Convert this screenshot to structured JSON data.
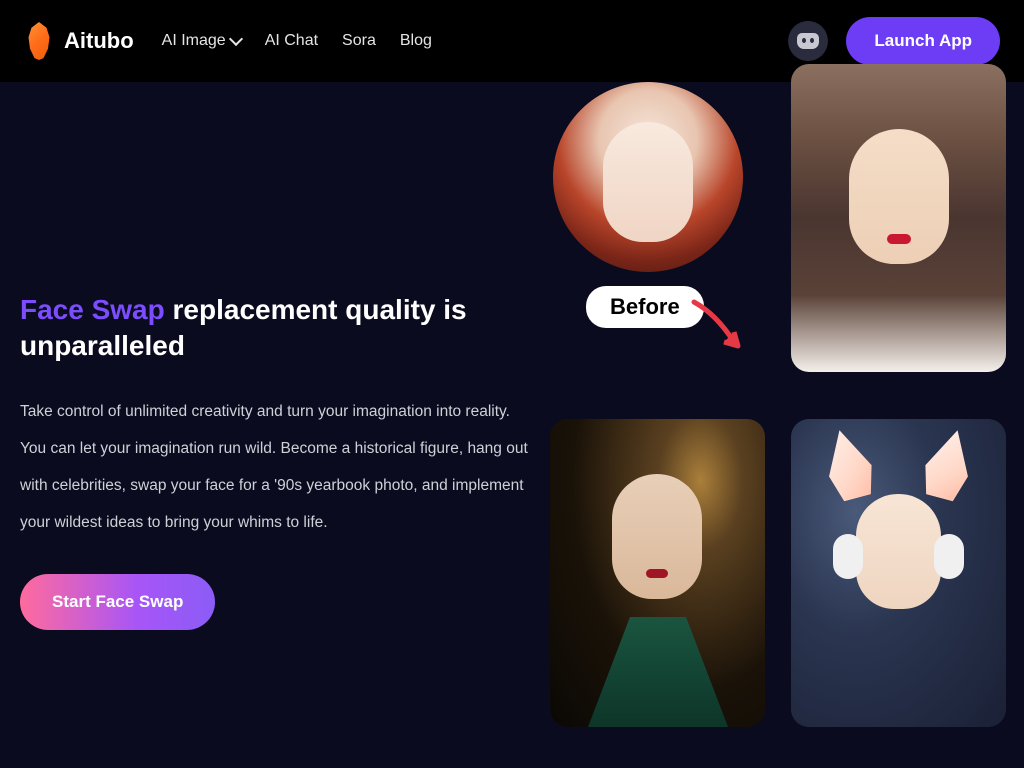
{
  "header": {
    "brand": "Aitubo",
    "nav": {
      "ai_image": "AI Image",
      "ai_chat": "AI Chat",
      "sora": "Sora",
      "blog": "Blog"
    },
    "launch_label": "Launch App"
  },
  "hero": {
    "heading_highlight": "Face Swap",
    "heading_rest": " replacement quality is unparalleled",
    "description": "Take control of unlimited creativity and turn your imagination into reality. You can let your imagination run wild. Become a historical figure, hang out with celebrities, swap your face for a '90s yearbook photo, and implement your wildest ideas to bring your whims to life.",
    "cta_label": "Start Face Swap"
  },
  "gallery": {
    "before_label": "Before"
  }
}
